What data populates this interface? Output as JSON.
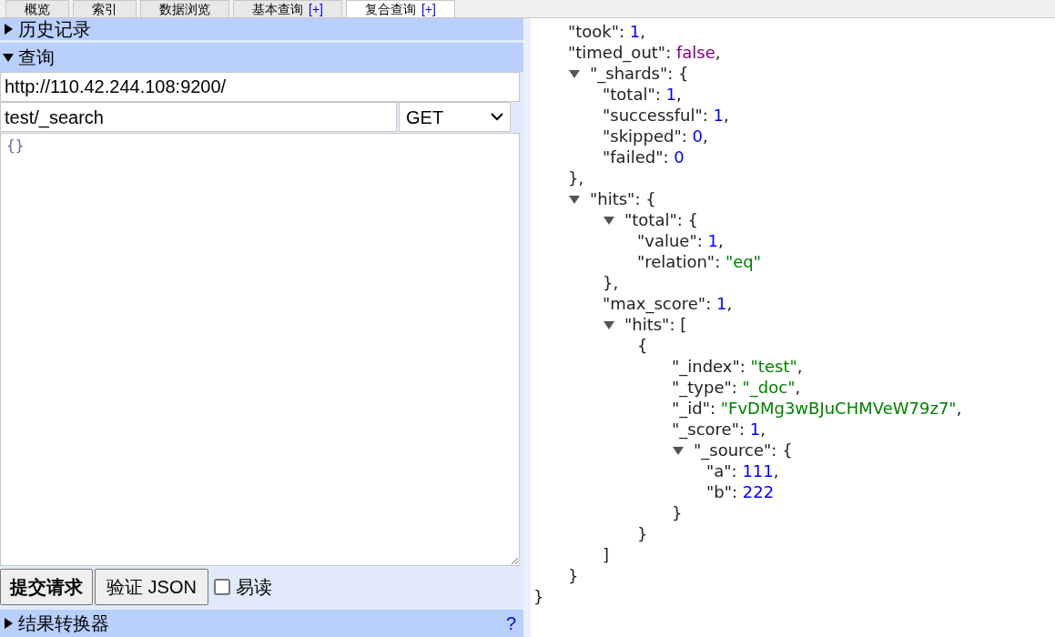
{
  "tabs": [
    {
      "label": "概览",
      "selected": false
    },
    {
      "label": "索引",
      "selected": false
    },
    {
      "label": "数据浏览",
      "selected": false
    },
    {
      "label": "基本查询",
      "extra": "[+]",
      "selected": false
    },
    {
      "label": "复合查询",
      "extra": "[+]",
      "selected": true
    }
  ],
  "history_section": {
    "label": "历史记录",
    "expanded": false
  },
  "query_section": {
    "label": "查询",
    "expanded": true
  },
  "query": {
    "url": "http://110.42.244.108:9200/",
    "path": "test/_search",
    "method": "GET",
    "body": "{}"
  },
  "actions": {
    "submit": "提交请求",
    "validate": "验证 JSON",
    "pretty": {
      "label": "易读",
      "checked": false
    }
  },
  "converter_section": {
    "label": "结果转换器",
    "expanded": false,
    "help": "?"
  },
  "result": {
    "close": "}",
    "children": [
      {
        "key": "\"took\": ",
        "value": "1",
        "kind": "number",
        "trail": ","
      },
      {
        "key": "\"timed_out\": ",
        "value": "false",
        "kind": "boolean",
        "trail": ","
      },
      {
        "key": "\"_shards\": ",
        "open": "{",
        "close": "},",
        "expanded": true,
        "children": [
          {
            "key": "\"total\": ",
            "value": "1",
            "kind": "number",
            "trail": ","
          },
          {
            "key": "\"successful\": ",
            "value": "1",
            "kind": "number",
            "trail": ","
          },
          {
            "key": "\"skipped\": ",
            "value": "0",
            "kind": "number",
            "trail": ","
          },
          {
            "key": "\"failed\": ",
            "value": "0",
            "kind": "number"
          }
        ]
      },
      {
        "key": "\"hits\": ",
        "open": "{",
        "close": "}",
        "expanded": true,
        "children": [
          {
            "key": "\"total\": ",
            "open": "{",
            "close": "},",
            "expanded": true,
            "children": [
              {
                "key": "\"value\": ",
                "value": "1",
                "kind": "number",
                "trail": ","
              },
              {
                "key": "\"relation\": ",
                "value": "\"eq\"",
                "kind": "string"
              }
            ]
          },
          {
            "key": "\"max_score\": ",
            "value": "1",
            "kind": "number",
            "trail": ","
          },
          {
            "key": "\"hits\": ",
            "open": "[",
            "close": "]",
            "expanded": true,
            "children": [
              {
                "open": "{",
                "close": "}",
                "children": [
                  {
                    "key": "\"_index\": ",
                    "value": "\"test\"",
                    "kind": "string",
                    "trail": ","
                  },
                  {
                    "key": "\"_type\": ",
                    "value": "\"_doc\"",
                    "kind": "string",
                    "trail": ","
                  },
                  {
                    "key": "\"_id\": ",
                    "value": "\"FvDMg3wBJuCHMVeW79z7\"",
                    "kind": "string",
                    "trail": ","
                  },
                  {
                    "key": "\"_score\": ",
                    "value": "1",
                    "kind": "number",
                    "trail": ","
                  },
                  {
                    "key": "\"_source\": ",
                    "open": "{",
                    "close": "}",
                    "expanded": true,
                    "children": [
                      {
                        "key": "\"a\": ",
                        "value": "111",
                        "kind": "number",
                        "trail": ","
                      },
                      {
                        "key": "\"b\": ",
                        "value": "222",
                        "kind": "number"
                      }
                    ]
                  }
                ]
              }
            ]
          }
        ]
      }
    ]
  }
}
